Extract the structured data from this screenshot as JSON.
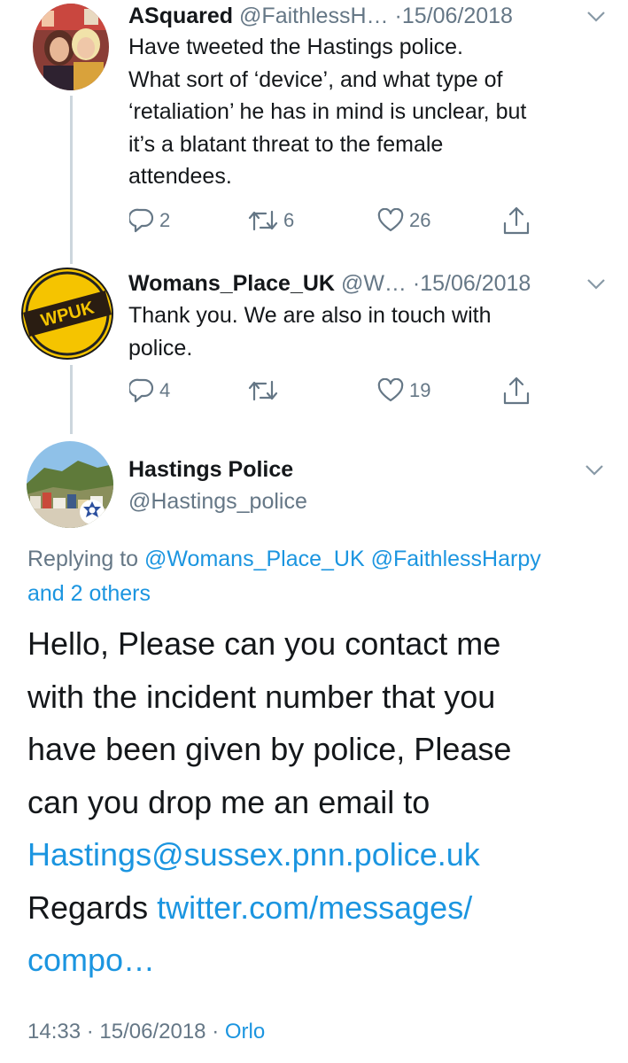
{
  "tweets": [
    {
      "name": "ASquared",
      "handle": "@FaithlessH…",
      "date": "15/06/2018",
      "text_lines": [
        "Have tweeted the Hastings police.",
        "What sort of ‘device’, and what type of",
        "‘retaliation’ he has in mind is unclear, but",
        "it’s a blatant threat to the female",
        "attendees."
      ],
      "replies": "2",
      "retweets": "6",
      "likes": "26"
    },
    {
      "name": "Womans_Place_UK",
      "handle": "@W…",
      "date": "15/06/2018",
      "avatar_text": "WPUK",
      "text_lines": [
        "Thank you. We are also in touch with",
        "police."
      ],
      "replies": "4",
      "retweets": "",
      "likes": "19"
    }
  ],
  "main_tweet": {
    "name": "Hastings Police",
    "handle": "@Hastings_police",
    "replying_prefix": "Replying to",
    "reply_to_1": "@Womans_Place_UK",
    "reply_to_2": "@FaithlessHarpy",
    "reply_others": "and 2 others",
    "body_lines": [
      "Hello, Please can you contact me",
      "with the incident number that you",
      "have been given by police, Please",
      "can you drop me an email to"
    ],
    "email": "Hastings@sussex.pnn.police.uk",
    "regards": "Regards",
    "link_part1": "twitter.com/messages/",
    "link_part2": "compo…",
    "time": "14:33",
    "date": "15/06/2018",
    "source": "Orlo"
  },
  "colors": {
    "text": "#14171a",
    "secondary": "#657786",
    "link": "#1b95e0",
    "thread_line": "#ccd6dd",
    "wpuk_yellow": "#f5c400"
  },
  "icons": [
    "reply-icon",
    "retweet-icon",
    "like-icon",
    "share-icon",
    "chevron-down-icon",
    "police-badge-icon"
  ]
}
